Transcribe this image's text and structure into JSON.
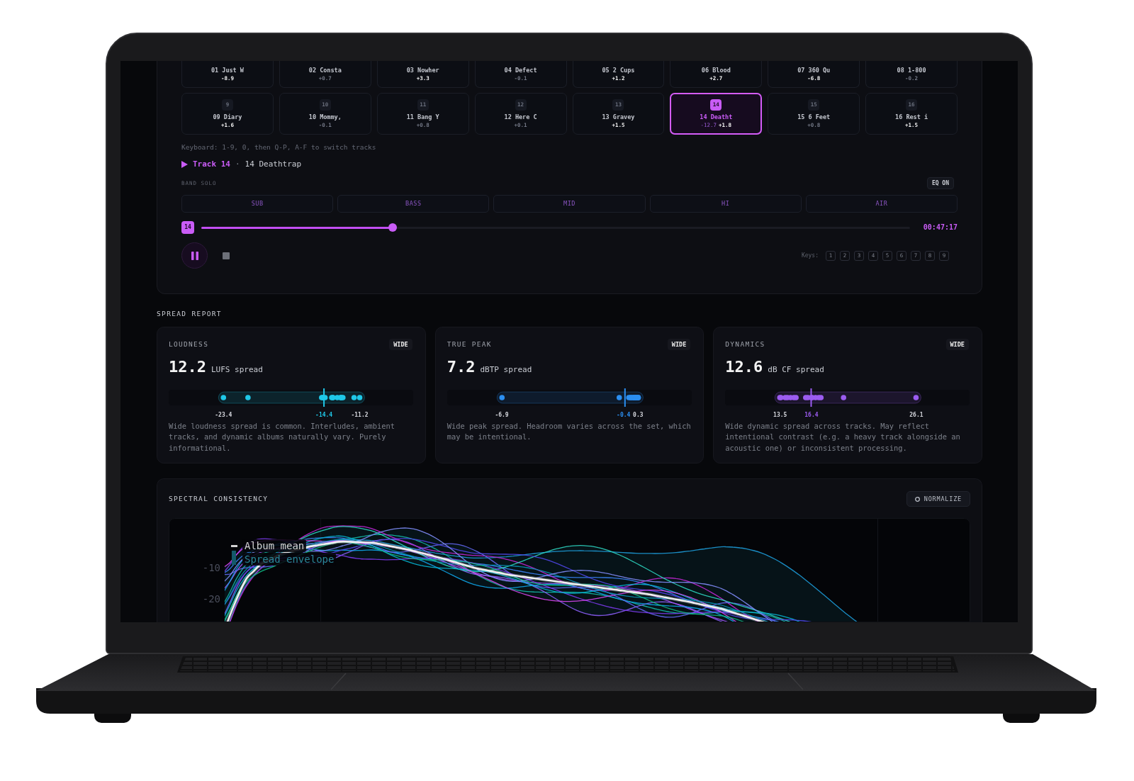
{
  "player": {
    "tracks": [
      {
        "name": "01 Just W",
        "delta": "-8.9",
        "flagged": true,
        "selected": false
      },
      {
        "name": "02 Consta",
        "delta": "+0.7",
        "flagged": false,
        "selected": false
      },
      {
        "name": "03 Nowher",
        "delta": "+3.3",
        "flagged": true,
        "selected": false
      },
      {
        "name": "04 Defect",
        "delta": "-0.1",
        "flagged": false,
        "selected": false
      },
      {
        "name": "05 2 Cups",
        "delta": "+1.2",
        "flagged": true,
        "selected": false
      },
      {
        "name": "06 Blood",
        "delta": "+2.7",
        "flagged": true,
        "selected": false
      },
      {
        "name": "07 360 Qu",
        "delta": "-6.8",
        "flagged": true,
        "selected": false
      },
      {
        "name": "08 1-800",
        "delta": "-0.2",
        "flagged": false,
        "selected": false
      },
      {
        "badge": "9",
        "name": "09 Diary",
        "delta": "+1.6",
        "flagged": true,
        "selected": false
      },
      {
        "badge": "10",
        "name": "10 Mommy,",
        "delta": "-0.1",
        "flagged": false,
        "selected": false
      },
      {
        "badge": "11",
        "name": "11 Bang Y",
        "delta": "+0.8",
        "flagged": false,
        "selected": false
      },
      {
        "badge": "12",
        "name": "12 Here C",
        "delta": "+0.1",
        "flagged": false,
        "selected": false
      },
      {
        "badge": "13",
        "name": "13 Gravey",
        "delta": "+1.5",
        "flagged": true,
        "selected": false
      },
      {
        "badge": "14",
        "name": "14 Deatht",
        "lufs": "-12.7",
        "delta": "+1.8",
        "flagged": true,
        "selected": true
      },
      {
        "badge": "15",
        "name": "15 6 Feet",
        "delta": "+0.8",
        "flagged": false,
        "selected": false
      },
      {
        "badge": "16",
        "name": "16 Rest i",
        "delta": "+1.5",
        "flagged": true,
        "selected": false
      }
    ],
    "keyboard_hint": "Keyboard: 1-9, 0, then Q-P, A-F to switch tracks",
    "now_playing": {
      "label": "Track 14",
      "separator": "·",
      "title": "14 Deathtrap"
    },
    "band_solo": {
      "label": "BAND SOLO",
      "eq_button": "EQ ON",
      "bands": [
        "SUB",
        "BASS",
        "MID",
        "HI",
        "AIR"
      ]
    },
    "seek": {
      "badge": "14",
      "level": 0.27,
      "time": "00:47:17"
    },
    "transport": {
      "playing": true
    },
    "keys": {
      "label": "Keys:",
      "items": [
        "1",
        "2",
        "3",
        "4",
        "5",
        "6",
        "7",
        "8",
        "9"
      ]
    }
  },
  "spread_report": {
    "title": "SPREAD REPORT",
    "cards": [
      {
        "title": "LOUDNESS",
        "badge": "WIDE",
        "value": "12.2",
        "unit": "LUFS spread",
        "color": "#1fc8e8",
        "strip": {
          "min_label": "-23.4",
          "mean_label": "-14.4",
          "max_label": "-11.2"
        },
        "description": "Wide loudness spread is common. Interludes, ambient tracks, and dynamic albums naturally vary. Purely informational."
      },
      {
        "title": "TRUE PEAK",
        "badge": "WIDE",
        "value": "7.2",
        "unit": "dBTP spread",
        "color": "#2b8ef0",
        "strip": {
          "min_label": "-6.9",
          "mean_label": "-0.4",
          "max_label": "0.3"
        },
        "description": "Wide peak spread. Headroom varies across the set, which may be intentional."
      },
      {
        "title": "DYNAMICS",
        "badge": "WIDE",
        "value": "12.6",
        "unit": "dB CF spread",
        "color": "#9b5cf0",
        "strip": {
          "min_label": "13.5",
          "mean_label": "16.4",
          "max_label": "26.1"
        },
        "description": "Wide dynamic spread across tracks. May reflect intentional contrast (e.g. a heavy track alongside an acoustic one) or inconsistent processing."
      }
    ]
  },
  "spectral_consistency": {
    "title": "SPECTRAL CONSISTENCY",
    "normalize": {
      "label": "NORMALIZE",
      "checked": false
    },
    "y_tick_labels": [
      "-10",
      "-20"
    ],
    "legend": [
      {
        "kind": "line",
        "label": "Album mean"
      },
      {
        "kind": "band",
        "label": "Spread envelope"
      }
    ]
  }
}
